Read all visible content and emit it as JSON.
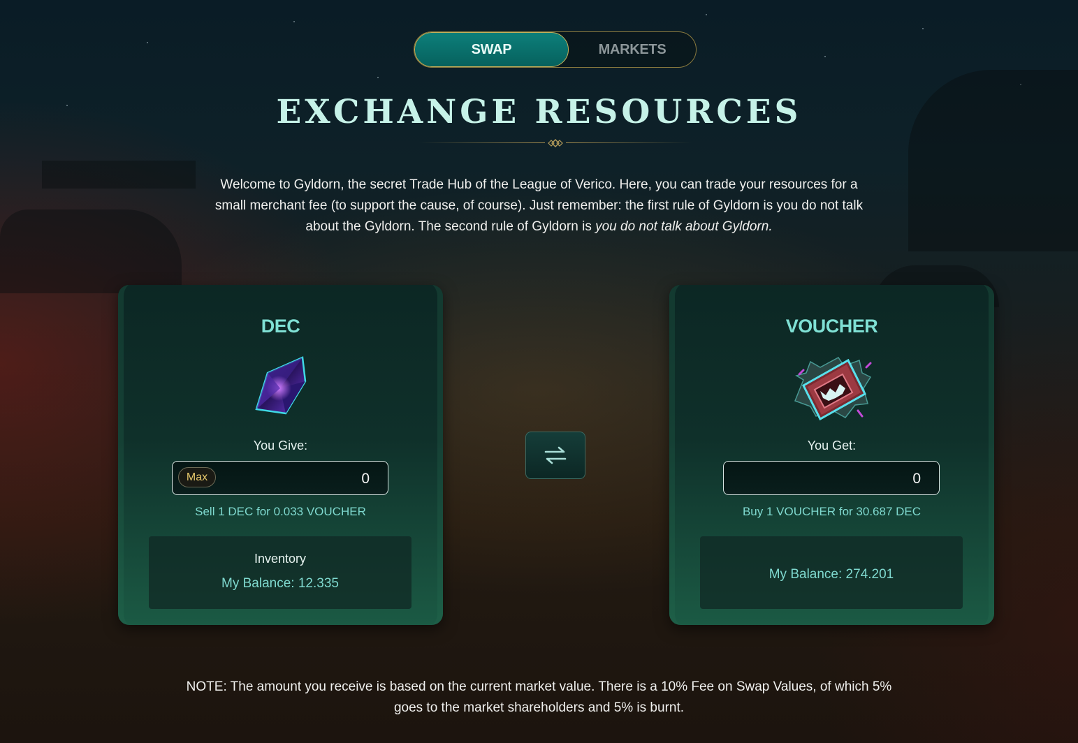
{
  "tabs": [
    {
      "label": "SWAP",
      "active": true
    },
    {
      "label": "MARKETS",
      "active": false
    }
  ],
  "title": "EXCHANGE RESOURCES",
  "intro": {
    "text": "Welcome to Gyldorn, the secret Trade Hub of the League of Verico. Here, you can trade your resources for a small merchant fee (to support the cause, of course). Just remember: the first rule of Gyldorn is you do not talk about the Gyldorn. The second rule of Gyldorn is ",
    "emphasis": "you do not talk about Gyldorn."
  },
  "give": {
    "title": "DEC",
    "icon": "dec-crystal-icon",
    "label": "You Give:",
    "max_label": "Max",
    "amount": "0",
    "rate": "Sell 1 DEC for 0.033 VOUCHER",
    "inventory_label": "Inventory",
    "balance": "My Balance: 12.335"
  },
  "get": {
    "title": "VOUCHER",
    "icon": "voucher-icon",
    "label": "You Get:",
    "amount": "0",
    "rate": "Buy 1 VOUCHER for 30.687 DEC",
    "balance": "My Balance: 274.201"
  },
  "swap_direction_icon": "swap-arrows-icon",
  "note": "NOTE: The amount you receive is based on the current market value. There is a 10% Fee on Swap Values, of which 5% goes to the market shareholders and 5% is burnt.",
  "colors": {
    "accent_teal": "#0d7f7a",
    "heading_mint": "#c6f2e8",
    "card_title": "#7fe0d4",
    "rate_text": "#7fd9cf",
    "gold_border": "#c8b15a",
    "max_text": "#e6c86c"
  }
}
